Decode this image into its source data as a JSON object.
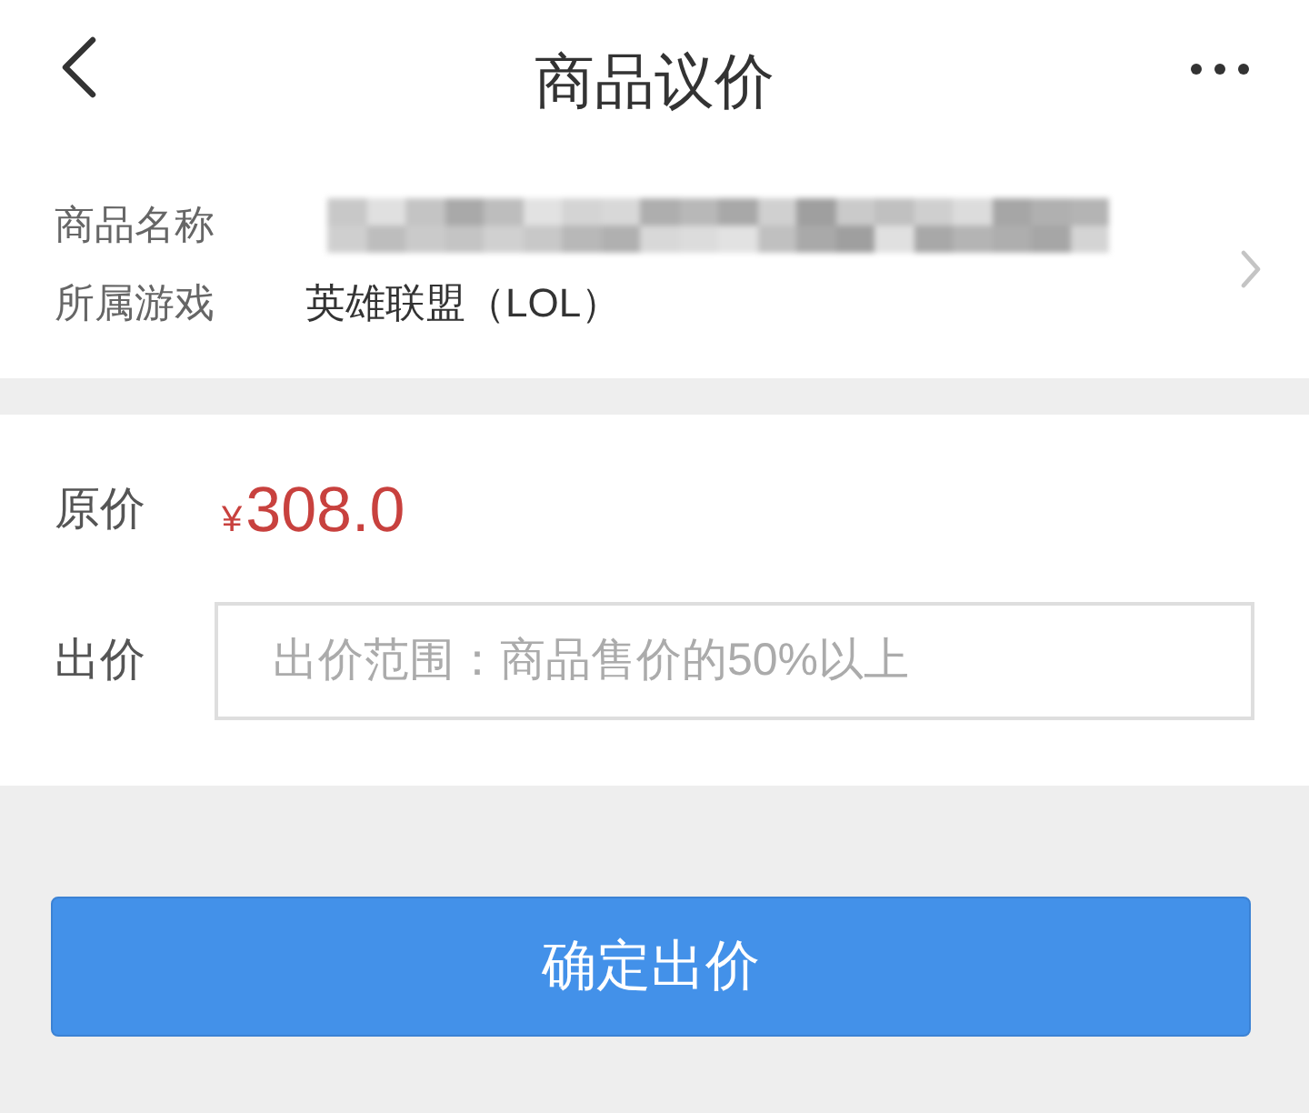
{
  "header": {
    "title": "商品议价"
  },
  "product_info": {
    "rows": [
      {
        "kind": "blurred",
        "label": "商品名称"
      },
      {
        "kind": "text",
        "label": "所属游戏",
        "value": "英雄联盟（LOL）"
      }
    ]
  },
  "pricing": {
    "original": {
      "label": "原价",
      "currency": "¥",
      "amount": "308.0"
    },
    "offer": {
      "label": "出价",
      "placeholder": "出价范围：商品售价的50%以上"
    }
  },
  "confirm_button": {
    "label": "确定出价"
  }
}
